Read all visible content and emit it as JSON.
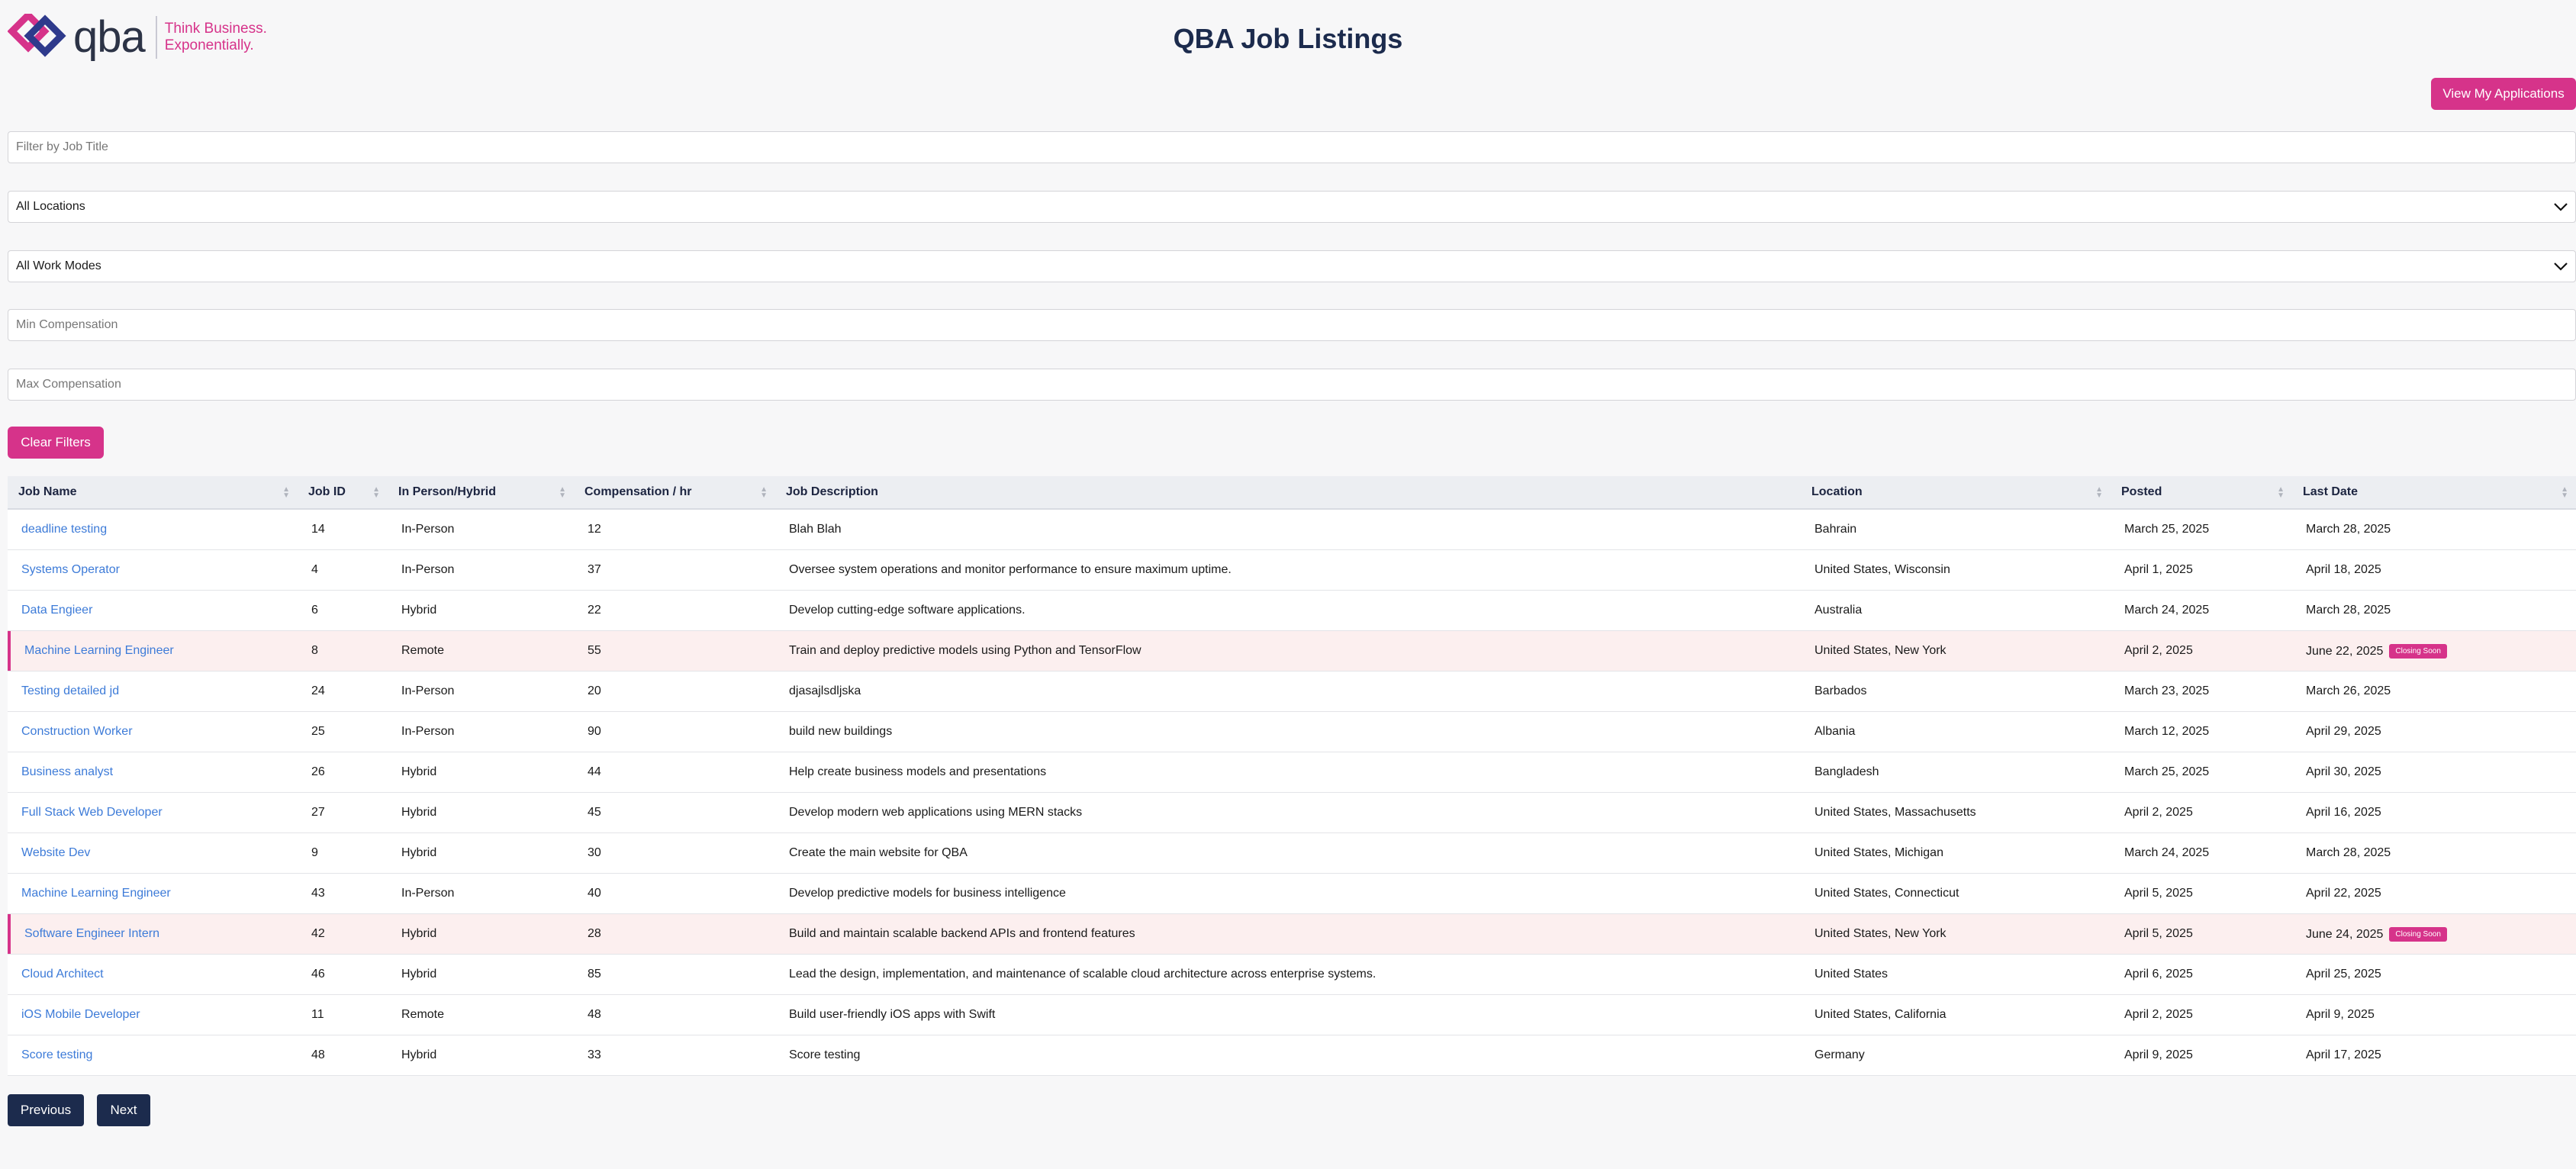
{
  "header": {
    "logo_text": "qba",
    "tagline_1": "Think Business.",
    "tagline_2": "Exponentially.",
    "title": "QBA Job Listings",
    "view_apps_label": "View My Applications"
  },
  "filters": {
    "title_placeholder": "Filter by Job Title",
    "location_selected": "All Locations",
    "workmode_selected": "All Work Modes",
    "min_comp_placeholder": "Min Compensation",
    "max_comp_placeholder": "Max Compensation",
    "clear_label": "Clear Filters"
  },
  "table": {
    "columns": [
      "Job Name",
      "Job ID",
      "In Person/Hybrid",
      "Compensation / hr",
      "Job Description",
      "Location",
      "Posted",
      "Last Date"
    ],
    "badge_text": "Closing Soon",
    "rows": [
      {
        "name": "deadline testing",
        "id": "14",
        "mode": "In-Person",
        "comp": "12",
        "desc": "Blah Blah",
        "location": "Bahrain",
        "posted": "March 25, 2025",
        "last": "March 28, 2025",
        "closing": false
      },
      {
        "name": "Systems Operator",
        "id": "4",
        "mode": "In-Person",
        "comp": "37",
        "desc": "Oversee system operations and monitor performance to ensure maximum uptime.",
        "location": "United States, Wisconsin",
        "posted": "April 1, 2025",
        "last": "April 18, 2025",
        "closing": false
      },
      {
        "name": "Data Engieer",
        "id": "6",
        "mode": "Hybrid",
        "comp": "22",
        "desc": "Develop cutting-edge software applications.",
        "location": "Australia",
        "posted": "March 24, 2025",
        "last": "March 28, 2025",
        "closing": false
      },
      {
        "name": "Machine Learning Engineer",
        "id": "8",
        "mode": "Remote",
        "comp": "55",
        "desc": "Train and deploy predictive models using Python and TensorFlow",
        "location": "United States, New York",
        "posted": "April 2, 2025",
        "last": "June 22, 2025",
        "closing": true
      },
      {
        "name": "Testing detailed jd",
        "id": "24",
        "mode": "In-Person",
        "comp": "20",
        "desc": "djasajlsdljska",
        "location": "Barbados",
        "posted": "March 23, 2025",
        "last": "March 26, 2025",
        "closing": false
      },
      {
        "name": "Construction Worker",
        "id": "25",
        "mode": "In-Person",
        "comp": "90",
        "desc": "build new buildings",
        "location": "Albania",
        "posted": "March 12, 2025",
        "last": "April 29, 2025",
        "closing": false
      },
      {
        "name": "Business analyst",
        "id": "26",
        "mode": "Hybrid",
        "comp": "44",
        "desc": "Help create business models and presentations",
        "location": "Bangladesh",
        "posted": "March 25, 2025",
        "last": "April 30, 2025",
        "closing": false
      },
      {
        "name": "Full Stack Web Developer",
        "id": "27",
        "mode": "Hybrid",
        "comp": "45",
        "desc": "Develop modern web applications using MERN stacks",
        "location": "United States, Massachusetts",
        "posted": "April 2, 2025",
        "last": "April 16, 2025",
        "closing": false
      },
      {
        "name": "Website Dev",
        "id": "9",
        "mode": "Hybrid",
        "comp": "30",
        "desc": "Create the main website for QBA",
        "location": "United States, Michigan",
        "posted": "March 24, 2025",
        "last": "March 28, 2025",
        "closing": false
      },
      {
        "name": "Machine Learning Engineer",
        "id": "43",
        "mode": "In-Person",
        "comp": "40",
        "desc": "Develop predictive models for business intelligence",
        "location": "United States, Connecticut",
        "posted": "April 5, 2025",
        "last": "April 22, 2025",
        "closing": false
      },
      {
        "name": "Software Engineer Intern",
        "id": "42",
        "mode": "Hybrid",
        "comp": "28",
        "desc": "Build and maintain scalable backend APIs and frontend features",
        "location": "United States, New York",
        "posted": "April 5, 2025",
        "last": "June 24, 2025",
        "closing": true
      },
      {
        "name": "Cloud Architect",
        "id": "46",
        "mode": "Hybrid",
        "comp": "85",
        "desc": "Lead the design, implementation, and maintenance of scalable cloud architecture across enterprise systems.",
        "location": "United States",
        "posted": "April 6, 2025",
        "last": "April 25, 2025",
        "closing": false
      },
      {
        "name": "iOS Mobile Developer",
        "id": "11",
        "mode": "Remote",
        "comp": "48",
        "desc": "Build user-friendly iOS apps with Swift",
        "location": "United States, California",
        "posted": "April 2, 2025",
        "last": "April 9, 2025",
        "closing": false
      },
      {
        "name": "Score testing",
        "id": "48",
        "mode": "Hybrid",
        "comp": "33",
        "desc": "Score testing",
        "location": "Germany",
        "posted": "April 9, 2025",
        "last": "April 17, 2025",
        "closing": false
      }
    ]
  },
  "pagination": {
    "prev_label": "Previous",
    "next_label": "Next"
  },
  "colors": {
    "accent": "#d6338a",
    "navy": "#1c2b4d",
    "link": "#3d7bd8",
    "closing_row": "#fcefef"
  }
}
